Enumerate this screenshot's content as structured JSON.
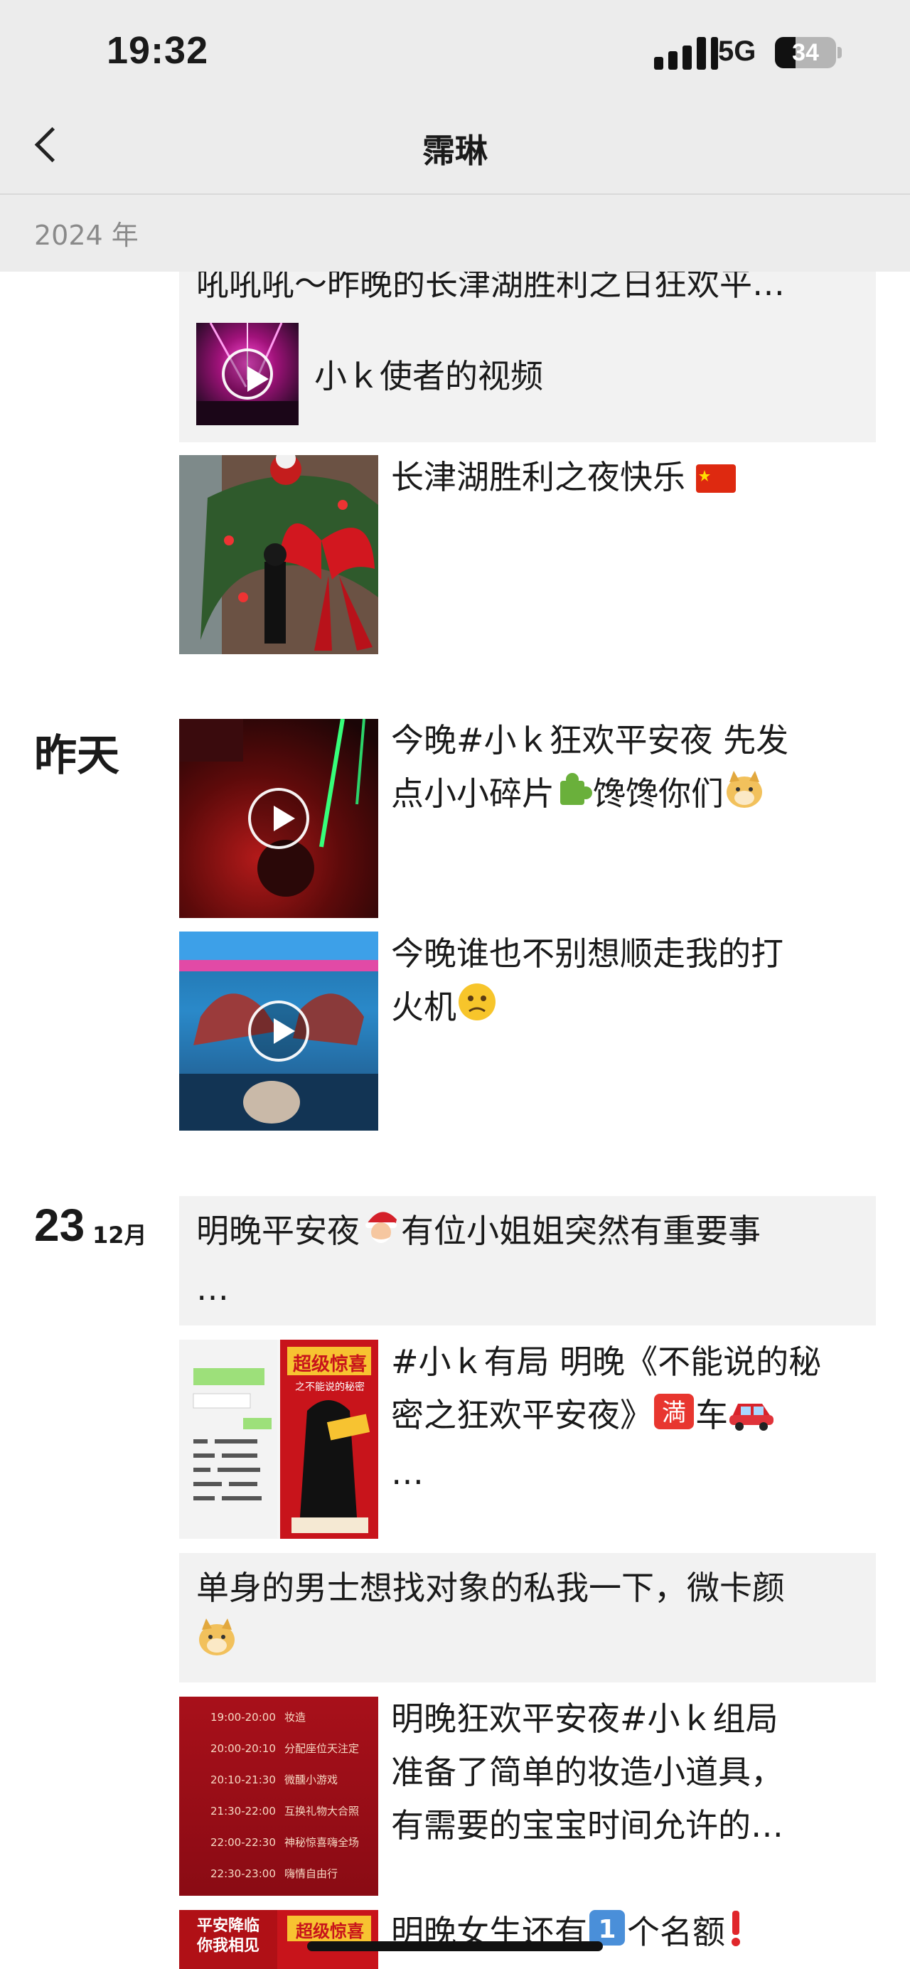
{
  "status": {
    "time": "19:32",
    "network": "5G",
    "battery": "34"
  },
  "header": {
    "title": "霈琳",
    "year": "2024 年"
  },
  "posts": {
    "p1_text": "吼吼吼～昨晚的长津湖胜利之日狂欢平…",
    "p1_link": "小ｋ使者的视频",
    "p2_text": "长津湖胜利之夜快乐",
    "date_yesterday": "昨天",
    "p3_text_a": "今晚#小ｋ狂欢平安夜 先发",
    "p3_text_b": "点小小碎片",
    "p3_text_c": "馋馋你们",
    "p4_text_a": "今晚谁也不别想顺走我的打",
    "p4_text_b": "火机",
    "date_day": "23",
    "date_month": "12月",
    "p5_text_a": "明晚平安夜",
    "p5_text_b": "有位小姐姐突然有重要事",
    "p5_text_c": "…",
    "p6_text_a": "#小ｋ有局 明晚《不能说的秘",
    "p6_text_b": "密之狂欢平安夜》",
    "p6_text_c": "车",
    "p6_text_d": "…",
    "p7_text": "单身的男士想找对象的私我一下，微卡颜",
    "p8_text_a": "明晚狂欢平安夜#小ｋ组局",
    "p8_text_b": "准备了简单的妆造小道具，",
    "p8_text_c": "有需要的宝宝时间允许的…",
    "p9_text_a": "明晚女生还有",
    "p9_text_b": "个名额",
    "schedule": [
      [
        "19:00-20:00",
        "妆造"
      ],
      [
        "20:00-20:10",
        "分配座位天注定"
      ],
      [
        "20:10-21:30",
        "微醺小游戏"
      ],
      [
        "21:30-22:00",
        "互换礼物大合照"
      ],
      [
        "22:00-22:30",
        "神秘惊喜嗨全场"
      ],
      [
        "22:30-23:00",
        "嗨情自由行"
      ]
    ],
    "poster_title": "超级惊喜",
    "poster_sub": "之不能说的秘密",
    "poster2_title": "平安降临",
    "poster2_sub": "你我相见"
  },
  "colors": {
    "accent_red": "#c0141a",
    "card_gray": "#f2f2f2"
  }
}
